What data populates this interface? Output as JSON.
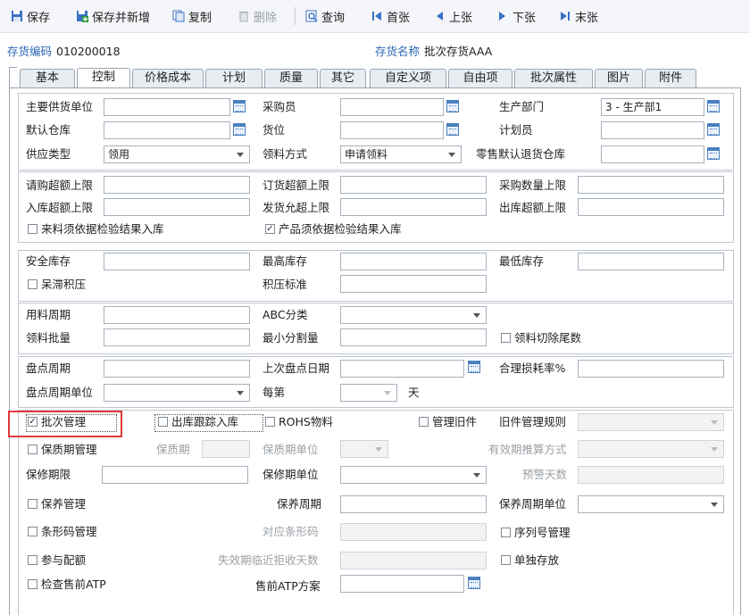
{
  "toolbar": {
    "save": "保存",
    "save_new": "保存并新增",
    "copy": "复制",
    "delete": "删除",
    "query": "查询",
    "first": "首张",
    "prev": "上张",
    "next": "下张",
    "last": "末张"
  },
  "header": {
    "code_label": "存货编码",
    "code_value": "010200018",
    "name_label": "存货名称",
    "name_value": "批次存货AAA"
  },
  "tabs": [
    "基本",
    "控制",
    "价格成本",
    "计划",
    "质量",
    "其它",
    "自定义项",
    "自由项",
    "批次属性",
    "图片",
    "附件"
  ],
  "active_tab": "控制",
  "form": {
    "g1": {
      "main_supplier": "主要供货单位",
      "buyer": "采购员",
      "prod_dept": "生产部门",
      "prod_dept_value": "3 - 生产部1",
      "default_wh": "默认仓库",
      "location": "货位",
      "planner": "计划员",
      "supply_type": "供应类型",
      "supply_type_value": "领用",
      "issue_method": "领料方式",
      "issue_method_value": "申请领料",
      "retail_return_wh": "零售默认退货仓库"
    },
    "g2": {
      "req_over": "请购超额上限",
      "order_over": "订货超额上限",
      "purchase_qty_limit": "采购数量上限",
      "in_over": "入库超额上限",
      "ship_over": "发货允超上限",
      "out_over": "出库超额上限",
      "incoming_inspect": "来料须依据检验结果入库",
      "product_inspect": "产品须依据检验结果入库"
    },
    "g3": {
      "safety_stock": "安全库存",
      "max_stock": "最高库存",
      "min_stock": "最低库存",
      "sluggish": "呆滞积压",
      "backlog_std": "积压标准"
    },
    "g4": {
      "usage_cycle": "用料周期",
      "abc": "ABC分类",
      "issue_batch": "领料批量",
      "min_split": "最小分割量",
      "cut_tail": "领料切除尾数"
    },
    "g5": {
      "count_cycle": "盘点周期",
      "last_count_date": "上次盘点日期",
      "loss_rate": "合理损耗率%",
      "count_cycle_unit": "盘点周期单位",
      "every": "每第",
      "day": "天"
    },
    "g6": {
      "batch_mgmt": "批次管理",
      "outbound_trace": "出库跟踪入库",
      "rohs": "ROHS物料",
      "old_parts": "管理旧件",
      "old_parts_rule": "旧件管理规则",
      "shelf_life_mgmt": "保质期管理",
      "shelf_life": "保质期",
      "shelf_life_unit": "保质期单位",
      "expiry_calc": "有效期推算方式",
      "warranty": "保修期限",
      "warranty_unit": "保修期单位",
      "warning_days": "预警天数",
      "maint_mgmt": "保养管理",
      "maint_cycle": "保养周期",
      "maint_cycle_unit": "保养周期单位",
      "barcode_mgmt": "条形码管理",
      "barcode_map": "对应条形码",
      "serial_mgmt": "序列号管理",
      "quota": "参与配额",
      "reject_days": "失效期临近拒收天数",
      "single_store": "单独存放",
      "check_atp": "检查售前ATP",
      "atp_plan": "售前ATP方案"
    }
  },
  "colors": {
    "accent": "#2a64b4",
    "highlight": "#e23b3b"
  }
}
